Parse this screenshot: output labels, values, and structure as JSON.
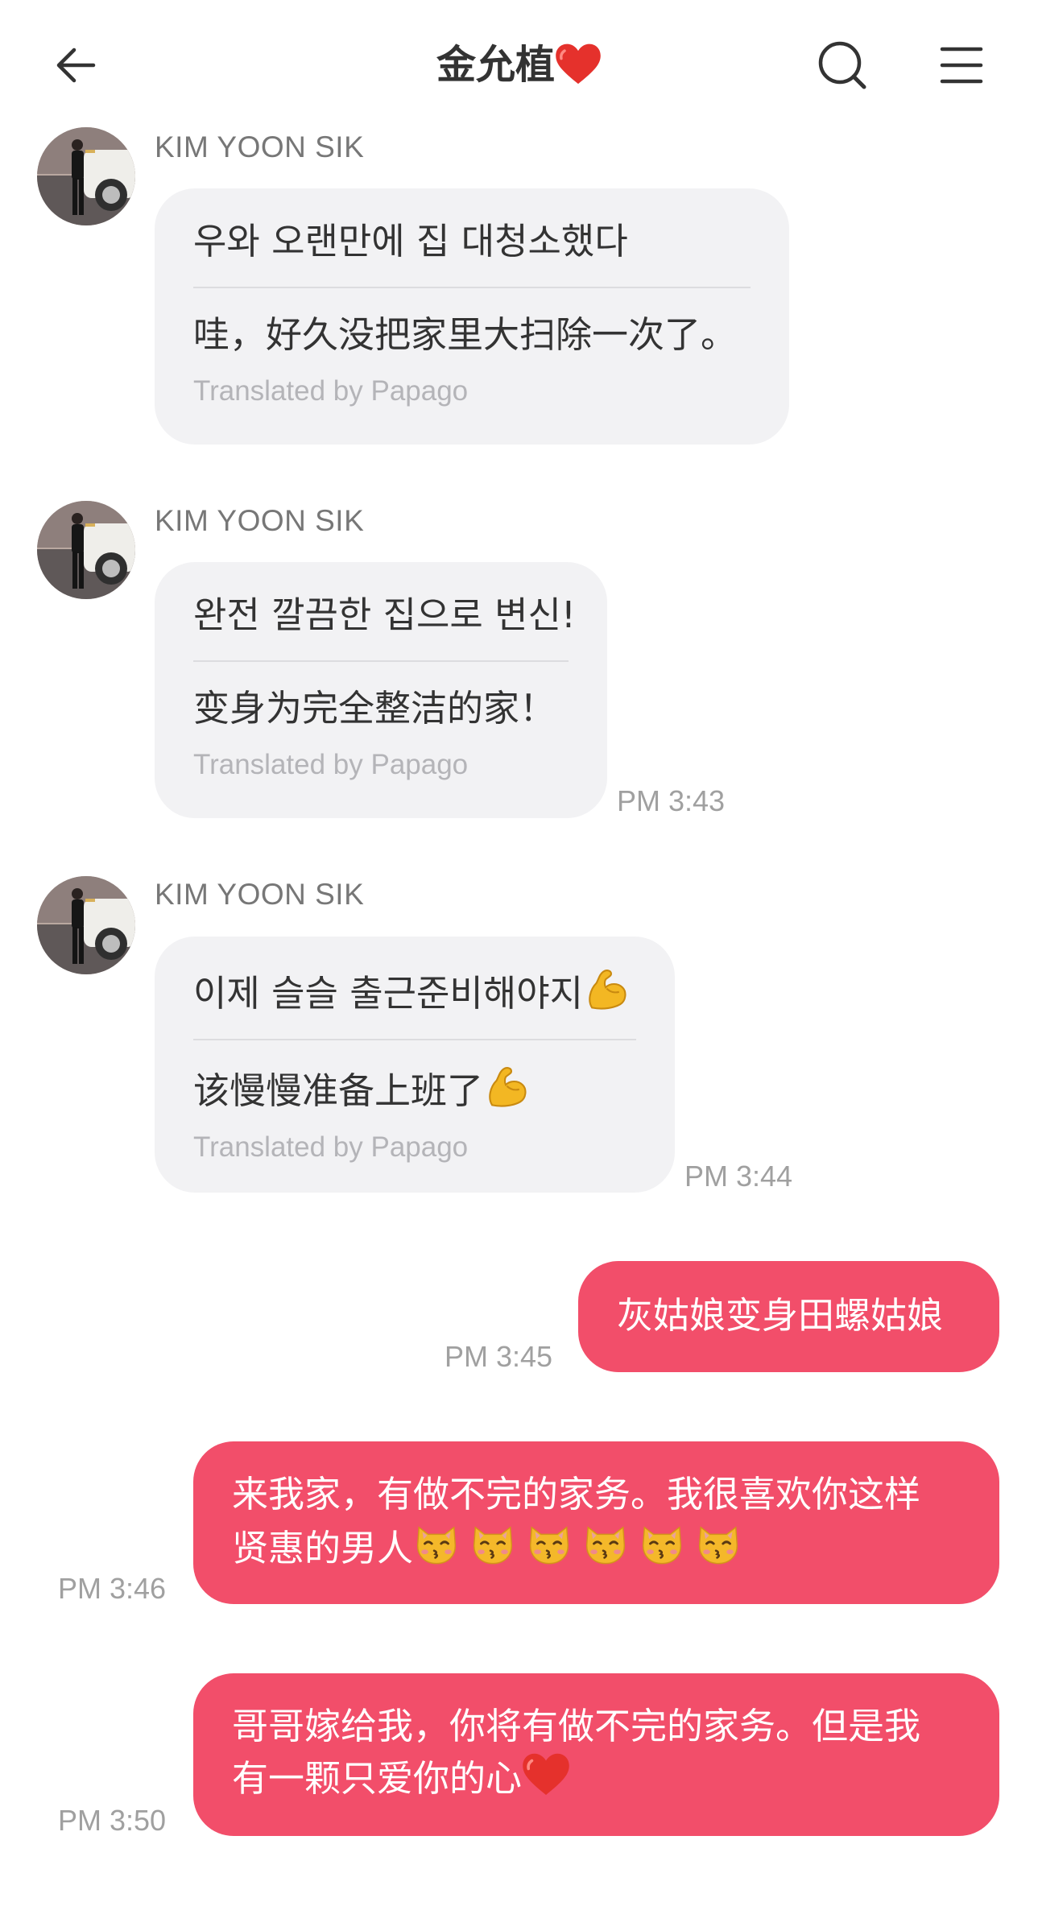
{
  "header": {
    "back_icon": "back-arrow-icon",
    "title": "金允植",
    "title_heart": "heart-icon",
    "search_icon": "search-icon",
    "menu_icon": "menu-icon"
  },
  "colors": {
    "outgoing_bubble": "#f24e6a",
    "incoming_bubble": "#f2f2f4",
    "heart": "#e5312c"
  },
  "messages": [
    {
      "sender": "KIM YOON SIK",
      "original": "우와 오랜만에 집 대청소했다",
      "translation": "哇，好久没把家里大扫除一次了。",
      "translated_by": "Translated by Papago",
      "time": ""
    },
    {
      "sender": "KIM YOON SIK",
      "original": "완전 깔끔한 집으로 변신!",
      "translation": "变身为完全整洁的家！",
      "translated_by": "Translated by Papago",
      "time": "PM 3:43"
    },
    {
      "sender": "KIM YOON SIK",
      "original": "이제 슬슬 출근준비해야지",
      "original_emoji": "flexed-biceps-icon",
      "translation": "该慢慢准备上班了",
      "translation_emoji": "flexed-biceps-icon",
      "translated_by": "Translated by Papago",
      "time": "PM 3:44"
    }
  ],
  "outgoing": [
    {
      "text": "灰姑娘变身田螺姑娘",
      "time": "PM 3:45"
    },
    {
      "line1": "来我家，有做不完的家务。我很喜欢你这样",
      "line2": "贤惠的男人",
      "emoji": "kissing-cat-icon",
      "emoji_count": 6,
      "time": "PM 3:46"
    },
    {
      "line1": "哥哥嫁给我，你将有做不完的家务。但是我",
      "line2": "有一颗只爱你的心",
      "emoji": "heart-icon",
      "time": "PM 3:50"
    }
  ]
}
